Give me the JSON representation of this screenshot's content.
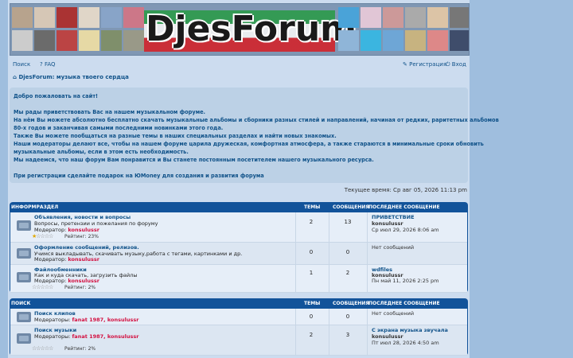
{
  "header": {
    "logo_text": "DjesForum"
  },
  "nav": {
    "search": "Поиск",
    "faq": "FAQ",
    "register": "Регистрация",
    "login": "Вход",
    "home": "DjesForum: музыка твоего сердца"
  },
  "welcome": {
    "lines": [
      "Добро пожаловать на сайт!",
      "",
      "Мы рады приветствовать Вас на нашем музыкальном форуме.",
      "На нём Вы можете абсолютно бесплатно скачать музыкальные альбомы и сборники разных стилей и направлений, начиная от редких, раритетных альбомов",
      "80-х годов и заканчивая самыми последними новинками этого года.",
      "Также Вы можете пообщаться на разные темы в наших специальных разделах и найти новых знакомых.",
      "Наши модераторы делают все, чтобы на нашем форуме царила дружеская, комфортная атмосфера, а также стараются в минимальные сроки обновить",
      "музыкальные альбомы, если в этом есть необходимость.",
      "Мы надеемся, что наш форум Вам понравится и Вы станете постоянным посетителем нашего музыкального ресурса.",
      "",
      "При регистрации сделайте подарок на ЮMoney для создания и развития форума"
    ]
  },
  "current_time": "Текущее время: Ср авг 05, 2026 11:13 pm",
  "columns": {
    "topics": "ТЕМЫ",
    "posts": "СООБЩЕНИЯ",
    "last": "ПОСЛЕДНЕЕ СООБЩЕНИЕ"
  },
  "categories": [
    {
      "title": "ИНФОРМРАЗДЕЛ",
      "forums": [
        {
          "title": "Объявления, новости и вопросы",
          "desc": "Вопросы, претензии и пожелания по форуму",
          "mod_label": "Модератор:",
          "mods": "konsulussr",
          "rating": "Рейтинг: 23%",
          "topics": "2",
          "posts": "13",
          "last_title": "ПРИВЕТСТВИЕ",
          "last_user": "konsulussr",
          "last_date": "Ср июл 29, 2026 8:06 am"
        },
        {
          "title": "Оформление сообщений, релизов.",
          "desc": "Учимся выкладывать, скачивать музыку,работа с тегами, картинками и др.",
          "mod_label": "Модератор:",
          "mods": "konsulussr",
          "rating": "",
          "topics": "0",
          "posts": "0",
          "last_title": "Нет сообщений",
          "last_user": "",
          "last_date": ""
        },
        {
          "title": "Файлообменники",
          "desc": "Как и куда скачать, загрузить файлы",
          "mod_label": "Модератор:",
          "mods": "konsulussr",
          "rating": "Рейтинг: 2%",
          "topics": "1",
          "posts": "2",
          "last_title": "wdfiles",
          "last_user": "konsulussr",
          "last_date": "Пн май 11, 2026 2:25 pm"
        }
      ]
    },
    {
      "title": "ПОИСК",
      "forums": [
        {
          "title": "Поиск клипов",
          "desc": "",
          "mod_label": "Модераторы:",
          "mods": "fanat 1987, konsulussr",
          "rating": "",
          "topics": "0",
          "posts": "0",
          "last_title": "Нет сообщений",
          "last_user": "",
          "last_date": ""
        },
        {
          "title": "Поиск музыки",
          "desc": "",
          "mod_label": "Модераторы:",
          "mods": "fanat 1987, konsulussr",
          "rating": "Рейтинг: 2%",
          "topics": "2",
          "posts": "3",
          "last_title": "С экрана музыка звучала",
          "last_user": "konsulussr",
          "last_date": "Пт июл 28, 2026 4:50 am"
        }
      ]
    }
  ]
}
